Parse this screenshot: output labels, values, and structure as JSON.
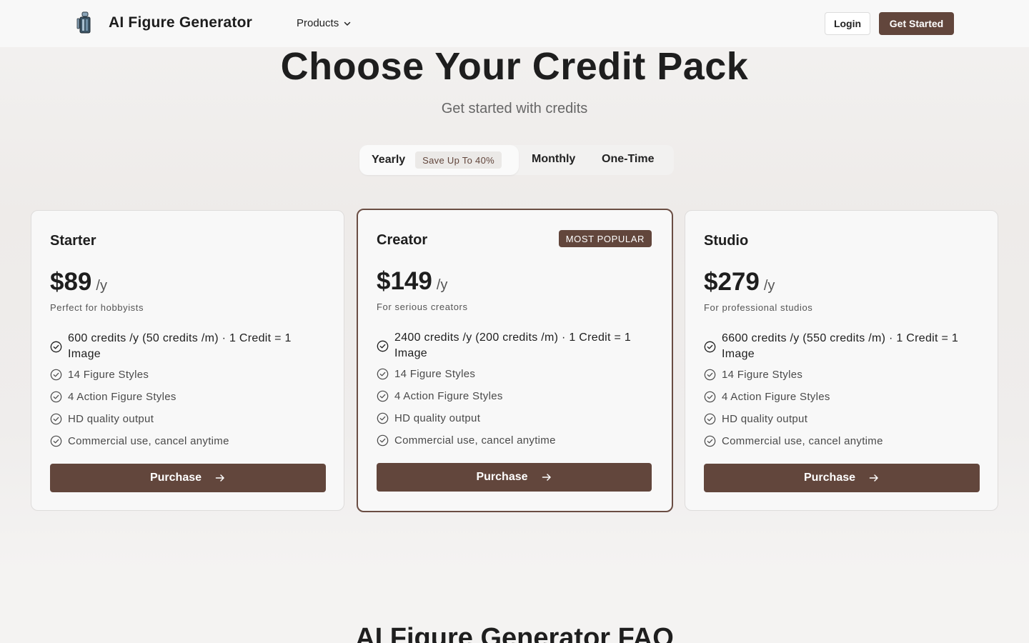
{
  "header": {
    "brand": "AI Figure Generator",
    "nav_products": "Products",
    "login": "Login",
    "get_started": "Get Started"
  },
  "hero": {
    "title": "Choose Your Credit Pack",
    "subtitle": "Get started with credits"
  },
  "billing_toggle": {
    "yearly": "Yearly",
    "save_badge": "Save Up To 40%",
    "monthly": "Monthly",
    "one_time": "One-Time",
    "selected": "Yearly"
  },
  "plans": [
    {
      "name": "Starter",
      "price": "$89",
      "period": "/y",
      "description": "Perfect for hobbyists",
      "credits": "600 credits /y (50 credits /m) · 1 Credit = 1 Image",
      "features": [
        "14 Figure Styles",
        "4 Action Figure Styles",
        "HD quality output",
        "Commercial use, cancel anytime"
      ],
      "cta": "Purchase"
    },
    {
      "name": "Creator",
      "badge": "MOST POPULAR",
      "price": "$149",
      "period": "/y",
      "description": "For serious creators",
      "credits": "2400 credits /y (200 credits /m) · 1 Credit = 1 Image",
      "features": [
        "14 Figure Styles",
        "4 Action Figure Styles",
        "HD quality output",
        "Commercial use, cancel anytime"
      ],
      "cta": "Purchase"
    },
    {
      "name": "Studio",
      "price": "$279",
      "period": "/y",
      "description": "For professional studios",
      "credits": "6600 credits /y (550 credits /m) · 1 Credit = 1 Image",
      "features": [
        "14 Figure Styles",
        "4 Action Figure Styles",
        "HD quality output",
        "Commercial use, cancel anytime"
      ],
      "cta": "Purchase"
    }
  ],
  "faq": {
    "title": "AI Figure Generator FAQ"
  },
  "colors": {
    "accent": "#62463c",
    "background": "#f3f2f1",
    "card": "#f8f8f8"
  }
}
